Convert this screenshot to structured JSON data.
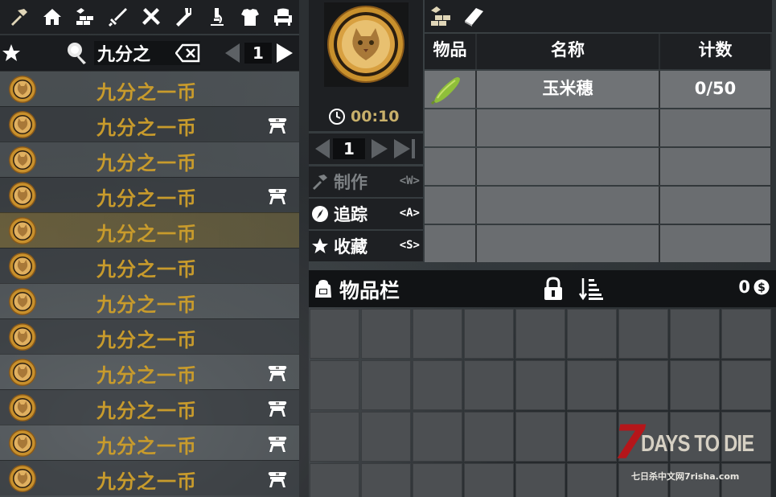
{
  "categories": [
    {
      "icon": "hammer-icon"
    },
    {
      "icon": "house-icon"
    },
    {
      "icon": "building-blocks-icon"
    },
    {
      "icon": "sword-icon"
    },
    {
      "icon": "crossed-tools-icon"
    },
    {
      "icon": "fork-icon"
    },
    {
      "icon": "microscope-icon"
    },
    {
      "icon": "armor-icon"
    },
    {
      "icon": "armchair-icon"
    }
  ],
  "search": {
    "value": "九分之",
    "page": "1"
  },
  "recipes": [
    {
      "name": "九分之一币",
      "workstation": false
    },
    {
      "name": "九分之一币",
      "workstation": true
    },
    {
      "name": "九分之一币",
      "workstation": false
    },
    {
      "name": "九分之一币",
      "workstation": true
    },
    {
      "name": "九分之一币",
      "workstation": false,
      "selected": true
    },
    {
      "name": "九分之一币",
      "workstation": false
    },
    {
      "name": "九分之一币",
      "workstation": false
    },
    {
      "name": "九分之一币",
      "workstation": false
    },
    {
      "name": "九分之一币",
      "workstation": true
    },
    {
      "name": "九分之一币",
      "workstation": true
    },
    {
      "name": "九分之一币",
      "workstation": true
    },
    {
      "name": "九分之一币",
      "workstation": true
    }
  ],
  "info": {
    "craft_time": "00:10",
    "quantity": "1",
    "actions": [
      {
        "label": "制作",
        "key": "<W>",
        "icon": "hammer-icon",
        "disabled": true
      },
      {
        "label": "追踪",
        "key": "<A>",
        "icon": "compass-icon",
        "disabled": false
      },
      {
        "label": "收藏",
        "key": "<S>",
        "icon": "star-icon",
        "disabled": false
      }
    ]
  },
  "ingredients": {
    "headers": {
      "item": "物品",
      "name": "名称",
      "count": "计数"
    },
    "rows": [
      {
        "icon": "corn-icon",
        "name": "玉米穗",
        "count": "0/50"
      }
    ],
    "empty_rows": 4
  },
  "inventory": {
    "title": "物品栏",
    "money": "0",
    "slots": 36
  },
  "logo": {
    "seven": "7",
    "title": "DAYS TO DIE",
    "subtitle": "七日杀中文网7risha.com"
  },
  "colors": {
    "recipe_name": "#c89b2c",
    "timer": "#c8b06a",
    "logo_red": "#b5161a",
    "selected_row": "#786a3c"
  }
}
